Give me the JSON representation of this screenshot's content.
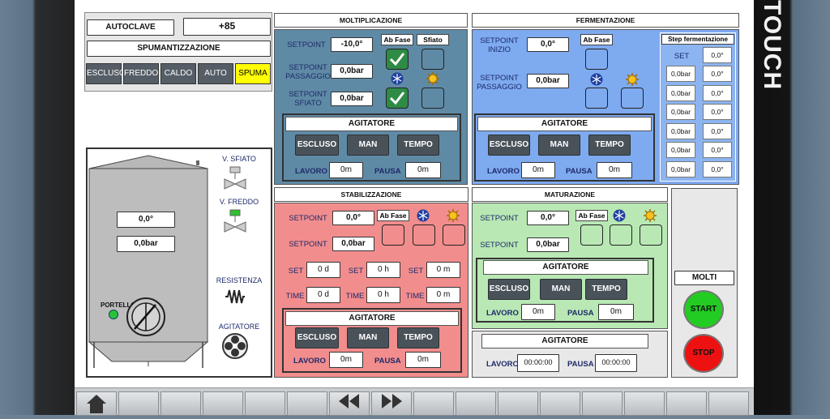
{
  "brand": "TOUCH",
  "autoclave": {
    "label": "AUTOCLAVE",
    "value": "+85",
    "title": "SPUMANTIZZAZIONE",
    "modes": [
      "ESCLUSO",
      "FREDDO",
      "CALDO",
      "AUTO",
      "SPUMA"
    ],
    "active_mode": "SPUMA"
  },
  "tank": {
    "temp": "0,0°",
    "pressure": "0,0bar",
    "portello": "PORTELLO",
    "v_sfiato": "V. SFIATO",
    "v_freddo": "V. FREDDO",
    "resistenza": "RESISTENZA",
    "agitatore": "AGITATORE"
  },
  "molti": {
    "title": "MOLTIPLICAZIONE",
    "setpoint_label": "SETPOINT",
    "setpoint": "-10,0°",
    "passaggio_label": "SETPOINT PASSAGGIO",
    "passaggio": "0,0bar",
    "sfiato_label": "SETPOINT SFIATO",
    "sfiato": "0,0bar",
    "ab_fase": "Ab Fase",
    "sfiato_tag": "Sfiato",
    "agitatore": "AGITATORE",
    "modes": [
      "ESCLUSO",
      "MAN",
      "TEMPO"
    ],
    "lavoro_label": "LAVORO",
    "lavoro": "0m",
    "pausa_label": "PAUSA",
    "pausa": "0m"
  },
  "ferm": {
    "title": "FERMENTAZIONE",
    "inizio_label": "SETPOINT INIZIO",
    "inizio": "0,0°",
    "passaggio_label": "SETPOINT PASSAGGIO",
    "passaggio": "0,0bar",
    "ab_fase": "Ab Fase",
    "agitatore": "AGITATORE",
    "modes": [
      "ESCLUSO",
      "MAN",
      "TEMPO"
    ],
    "lavoro_label": "LAVORO",
    "lavoro": "0m",
    "pausa_label": "PAUSA",
    "pausa": "0m",
    "step_title": "Step fermentazione",
    "set_label": "SET",
    "set_value": "0,0°",
    "steps": [
      [
        "0,0bar",
        "0,0°"
      ],
      [
        "0,0bar",
        "0,0°"
      ],
      [
        "0,0bar",
        "0,0°"
      ],
      [
        "0,0bar",
        "0,0°"
      ],
      [
        "0,0bar",
        "0,0°"
      ],
      [
        "0,0bar",
        "0,0°"
      ]
    ]
  },
  "stab": {
    "title": "STABILIZZAZIONE",
    "setpoint_label": "SETPOINT",
    "setpoint": "0,0°",
    "setpoint2_label": "SETPOINT",
    "setpoint2": "0,0bar",
    "ab_fase": "Ab Fase",
    "set_label": "SET",
    "time_label": "TIME",
    "set": [
      "0 d",
      "0 h",
      "0 m"
    ],
    "time": [
      "0 d",
      "0 h",
      "0 m"
    ],
    "agitatore": "AGITATORE",
    "modes": [
      "ESCLUSO",
      "MAN",
      "TEMPO"
    ],
    "lavoro_label": "LAVORO",
    "lavoro": "0m",
    "pausa_label": "PAUSA",
    "pausa": "0m"
  },
  "mat": {
    "title": "MATURAZIONE",
    "setpoint_label": "SETPOINT",
    "setpoint": "0,0°",
    "setpoint2_label": "SETPOINT",
    "setpoint2": "0,0bar",
    "ab_fase": "Ab Fase",
    "agitatore": "AGITATORE",
    "modes": [
      "ESCLUSO",
      "MAN",
      "TEMPO"
    ],
    "lavoro_label": "LAVORO",
    "lavoro": "0m",
    "pausa_label": "PAUSA",
    "pausa": "0m"
  },
  "agit2": {
    "title": "AGITATORE",
    "lavoro_label": "LAVORO",
    "lavoro": "00:00:00",
    "pausa_label": "PAUSA",
    "pausa": "00:00:00"
  },
  "control": {
    "title": "MOLTI",
    "start": "START",
    "stop": "STOP"
  },
  "colors": {
    "molti": "#5f8aa5",
    "ferm": "#7eaaf0",
    "stab": "#f28d8d",
    "mat": "#b9e8b4",
    "accent_yellow": "#ffff00",
    "start": "#22cc22",
    "stop": "#ee1111"
  },
  "taskbar": {
    "icons": [
      "home-icon",
      "rewind-icon",
      "fast-forward-icon"
    ]
  }
}
